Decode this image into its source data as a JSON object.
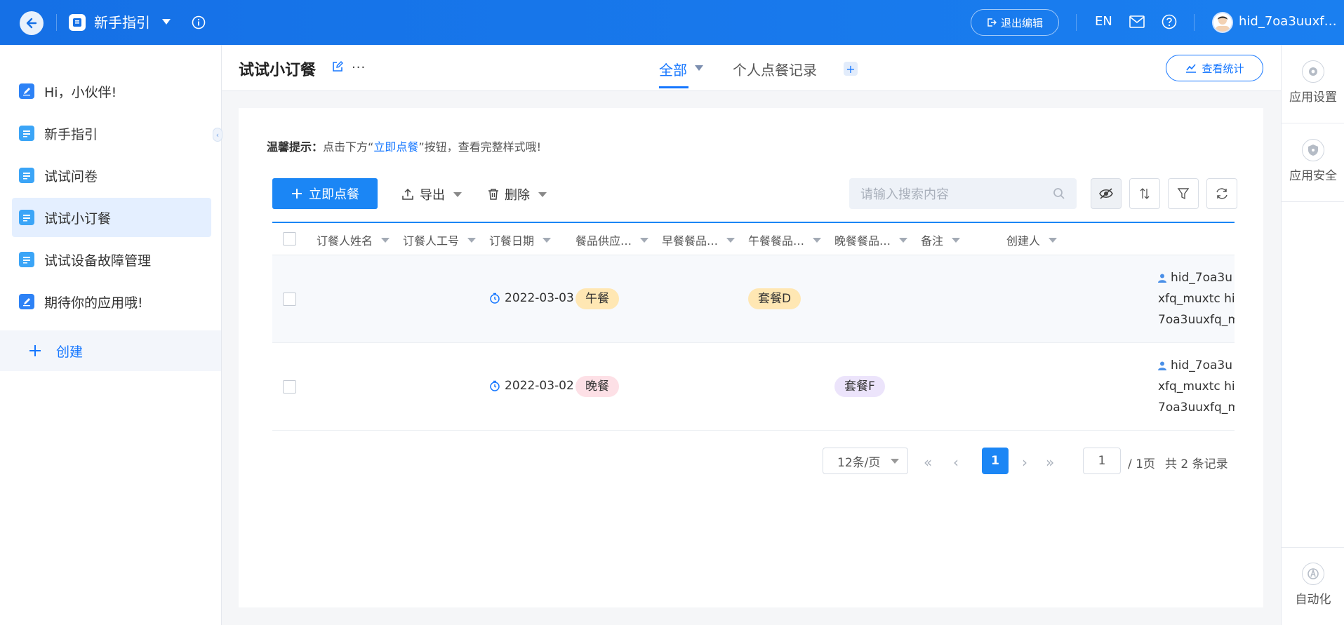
{
  "topbar": {
    "app_name": "新手指引",
    "exit_edit": "退出编辑",
    "lang": "EN",
    "username": "hid_7oa3uuxf…"
  },
  "sidebar": {
    "items": [
      {
        "label": "Hi，小伙伴!",
        "icon": "edit-doc-icon"
      },
      {
        "label": "新手指引",
        "icon": "list-doc-icon"
      },
      {
        "label": "试试问卷",
        "icon": "list-doc-icon"
      },
      {
        "label": "试试小订餐",
        "icon": "list-doc-icon",
        "active": true
      },
      {
        "label": "试试设备故障管理",
        "icon": "list-doc-icon"
      },
      {
        "label": "期待你的应用哦!",
        "icon": "edit-doc-icon"
      }
    ],
    "create": "创建"
  },
  "header": {
    "title": "试试小订餐",
    "more": "...",
    "tabs": [
      {
        "label": "全部",
        "active": true
      },
      {
        "label": "个人点餐记录",
        "active": false
      }
    ],
    "stats_button": "查看统计"
  },
  "rightbar": {
    "settings": "应用设置",
    "security": "应用安全",
    "automation": "自动化"
  },
  "content": {
    "tip_prefix": "温馨提示：",
    "tip_before": "点击下方“",
    "tip_link": "立即点餐",
    "tip_after": "”按钮，查看完整样式哦!",
    "order_button": "立即点餐",
    "export_button": "导出",
    "delete_button": "删除",
    "search_placeholder": "请输入搜索内容"
  },
  "table": {
    "columns": [
      "订餐人姓名",
      "订餐人工号",
      "订餐日期",
      "餐品供应…",
      "早餐餐品…",
      "午餐餐品…",
      "晚餐餐品…",
      "备注",
      "创建人"
    ],
    "rows": [
      {
        "name": "",
        "employee_id": "",
        "date": "2022-03-03",
        "supply": "午餐",
        "breakfast": "",
        "lunch": "套餐D",
        "dinner": "",
        "note": "",
        "creator": [
          "hid_7oa3u",
          "xfq_muxtc hic",
          "7oa3uuxfq_m"
        ]
      },
      {
        "name": "",
        "employee_id": "",
        "date": "2022-03-02",
        "supply": "晚餐",
        "breakfast": "",
        "lunch": "",
        "dinner": "套餐F",
        "note": "",
        "creator": [
          "hid_7oa3u",
          "xfq_muxtc hic",
          "7oa3uuxfq_m"
        ]
      }
    ]
  },
  "pagination": {
    "page_size": "12条/页",
    "current_page": "1",
    "jump_value": "1",
    "total_pages": "/ 1页",
    "total_records": "共 2 条记录"
  },
  "colors": {
    "primary": "#1677ff",
    "topbar": "#1a7ff0",
    "pill_lunch": "#ffe7b3",
    "pill_dinner": "#fde0e6",
    "pill_setF": "#ece4fb"
  }
}
